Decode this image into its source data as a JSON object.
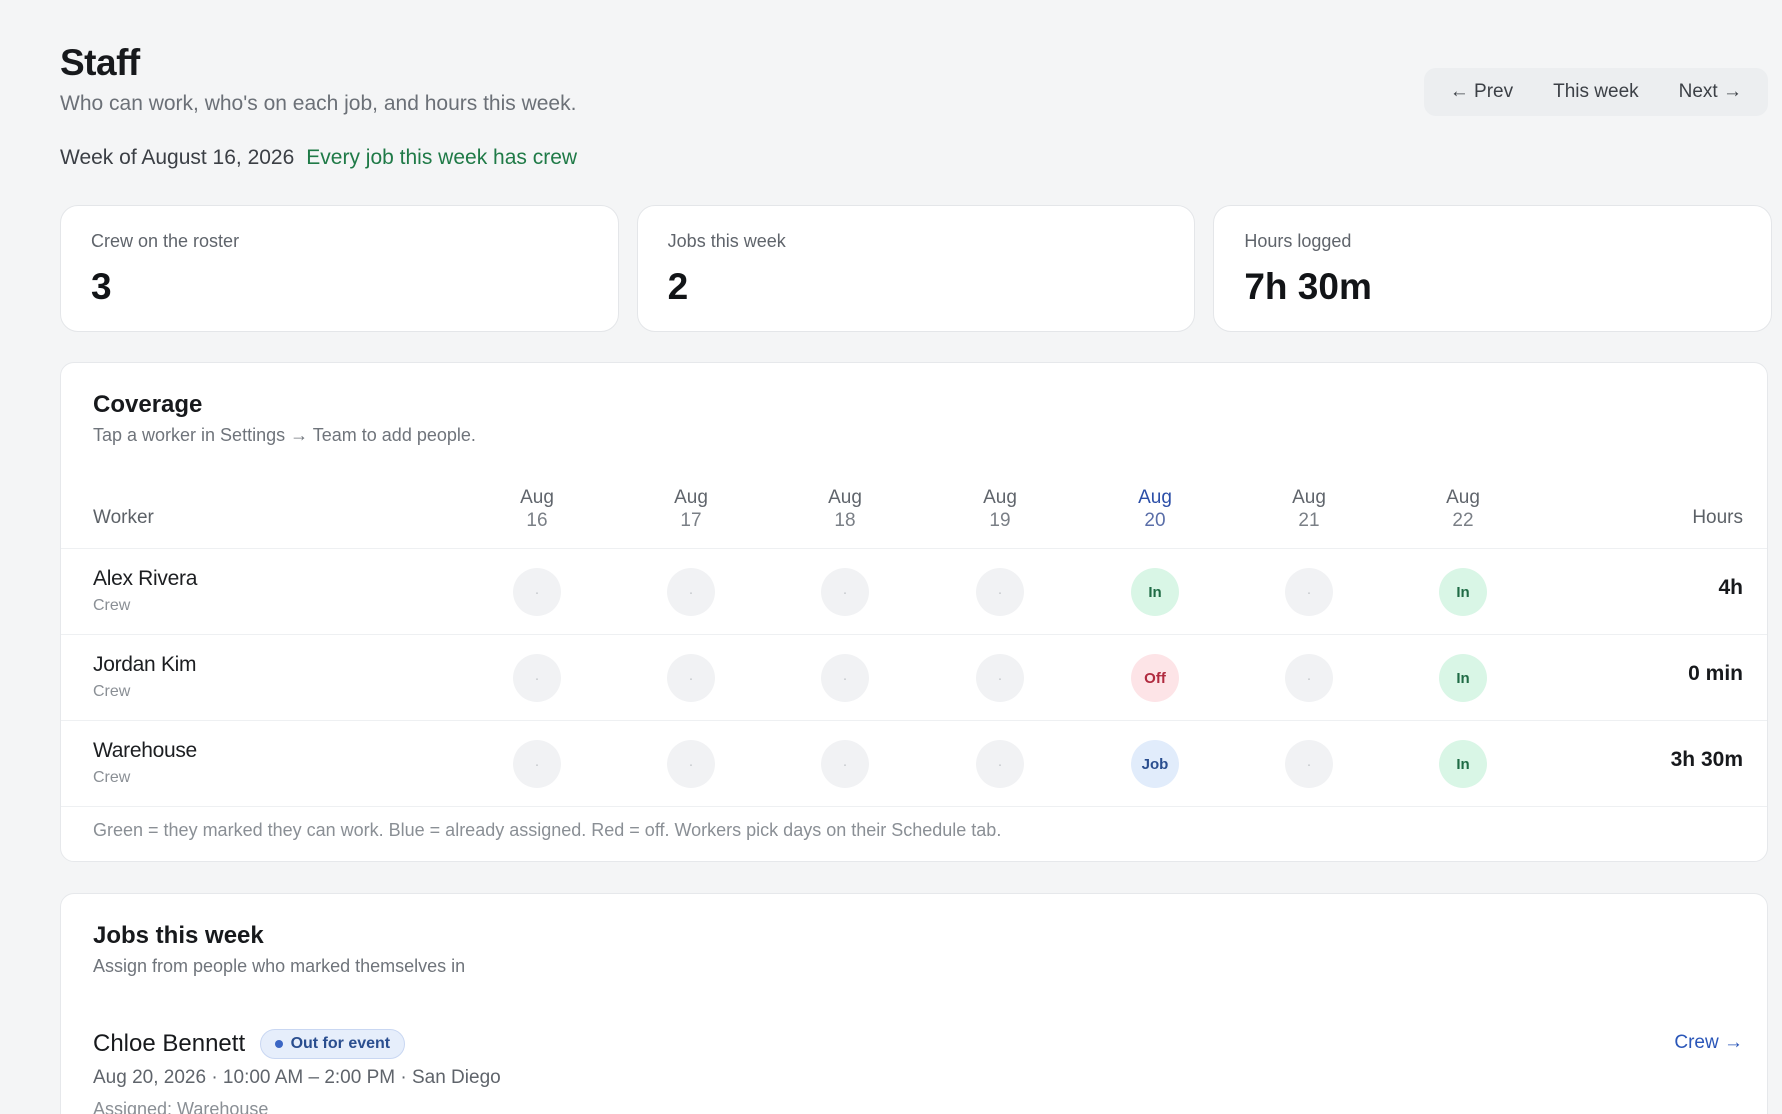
{
  "header": {
    "title": "Staff",
    "subtitle": "Who can work, who's on each job, and hours this week.",
    "week_label": "Week of August 16, 2026",
    "week_status": "Every job this week has crew"
  },
  "week_nav": {
    "prev": "← Prev",
    "current": "This week",
    "next": "Next →"
  },
  "stats": [
    {
      "label": "Crew on the roster",
      "value": "3"
    },
    {
      "label": "Jobs this week",
      "value": "2"
    },
    {
      "label": "Hours logged",
      "value": "7h 30m"
    }
  ],
  "coverage": {
    "title": "Coverage",
    "subtitle": "Tap a worker in Settings → Team to add people.",
    "col_worker": "Worker",
    "col_hours": "Hours",
    "days": [
      {
        "month": "Aug",
        "day": "16"
      },
      {
        "month": "Aug",
        "day": "17"
      },
      {
        "month": "Aug",
        "day": "18"
      },
      {
        "month": "Aug",
        "day": "19"
      },
      {
        "month": "Aug",
        "day": "20"
      },
      {
        "month": "Aug",
        "day": "21"
      },
      {
        "month": "Aug",
        "day": "22"
      }
    ],
    "empty_mark": "·",
    "rows": [
      {
        "name": "Alex Rivera",
        "role": "Crew",
        "cells": [
          "",
          "",
          "",
          "",
          "In",
          "",
          "In"
        ],
        "hours": "4h"
      },
      {
        "name": "Jordan Kim",
        "role": "Crew",
        "cells": [
          "",
          "",
          "",
          "",
          "Off",
          "",
          "In"
        ],
        "hours": "0 min"
      },
      {
        "name": "Warehouse",
        "role": "Crew",
        "cells": [
          "",
          "",
          "",
          "",
          "Job",
          "",
          "In"
        ],
        "hours": "3h 30m"
      }
    ],
    "legend": "Green = they marked they can work. Blue = already assigned. Red = off. Workers pick days on their Schedule tab."
  },
  "jobs": {
    "title": "Jobs this week",
    "subtitle": "Assign from people who marked themselves in",
    "items": [
      {
        "client": "Chloe Bennett",
        "status": "Out for event",
        "meta": "Aug 20, 2026 · 10:00 AM – 2:00 PM · San Diego",
        "assigned": "Assigned: Warehouse",
        "crew_link": "Crew →"
      }
    ]
  },
  "colors": {
    "in": "#d9f6e6",
    "off": "#fde4e7",
    "job": "#e1ecfb",
    "status_ok": "#1f7a47",
    "link": "#2a56b8"
  }
}
